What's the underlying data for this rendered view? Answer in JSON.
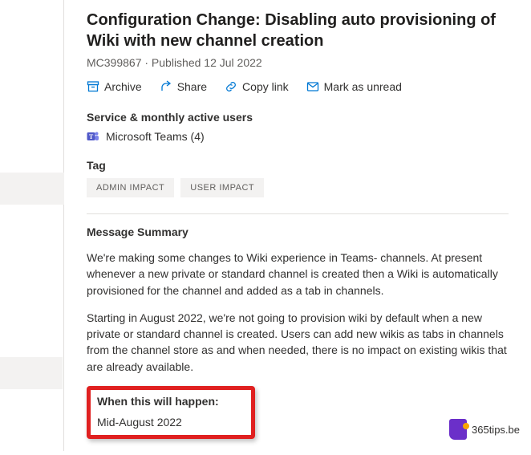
{
  "header": {
    "title": "Configuration Change: Disabling auto provisioning of Wiki with new channel creation",
    "meta": "MC399867 · Published 12 Jul 2022"
  },
  "actions": {
    "archive": "Archive",
    "share": "Share",
    "copylink": "Copy link",
    "markunread": "Mark as unread"
  },
  "service": {
    "section_label": "Service & monthly active users",
    "name": "Microsoft Teams (4)"
  },
  "tag": {
    "section_label": "Tag",
    "items": [
      "ADMIN IMPACT",
      "USER IMPACT"
    ]
  },
  "summary": {
    "heading": "Message Summary",
    "p1": "We're making some changes to Wiki experience in Teams- channels. At present whenever a new private or standard channel is created then a Wiki is automatically provisioned for the channel and added as a tab in channels.",
    "p2": "Starting in August 2022, we're not going to provision wiki by default when a new private or standard channel is created. Users can add new wikis as tabs in channels from the channel store as and when needed, there is no impact on existing wikis that are already available."
  },
  "highlight": {
    "heading": "When this will happen:",
    "value": "Mid-August 2022"
  },
  "watermark": {
    "text": "365tips.be"
  }
}
